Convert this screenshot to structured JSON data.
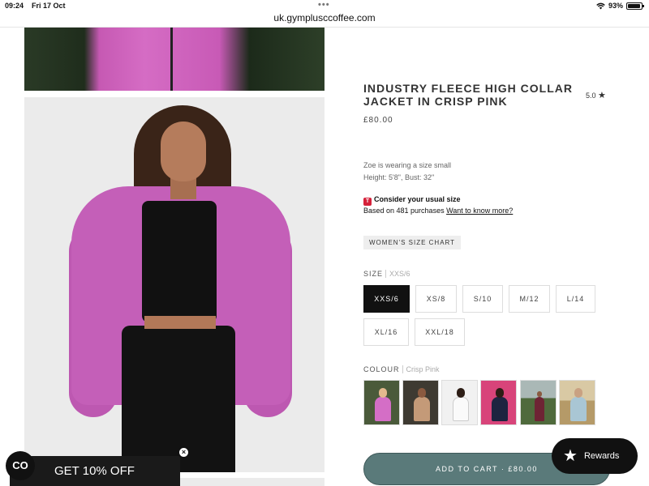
{
  "status_bar": {
    "time": "09:24",
    "date": "Fri 17 Oct",
    "battery": "93%",
    "battery_level": 0.93
  },
  "browser": {
    "url": "uk.gymplusccoffee.com"
  },
  "product": {
    "title": "INDUSTRY FLEECE HIGH COLLAR JACKET IN CRISP PINK",
    "rating": "5.0",
    "price": "£80.00",
    "model_info_line1": "Zoe is wearing a size small",
    "model_info_line2": "Height: 5'8\", Bust: 32\"",
    "fit_icon": "T",
    "fit_title": "Consider your usual size",
    "fit_text": "Based on 481 purchases ",
    "fit_link": "Want to know more?",
    "size_chart_label": "WOMEN'S SIZE CHART",
    "size_label": "SIZE",
    "selected_size": "XXS/6",
    "sizes": [
      "XXS/6",
      "XS/8",
      "S/10",
      "M/12",
      "L/14",
      "XL/16",
      "XXL/18"
    ],
    "colour_label": "COLOUR",
    "selected_colour": "Crisp Pink",
    "colour_swatches": [
      "pink-fleece-thumb",
      "tan-fleece-thumb",
      "white-fleece-thumb",
      "navy-on-pink-thumb",
      "maroon-outdoor-thumb",
      "light-blue-outdoor-thumb"
    ],
    "add_to_cart": "ADD TO CART · £80.00"
  },
  "rewards": {
    "label": "Rewards"
  },
  "promo": {
    "badge": "CO",
    "text": "GET 10% OFF",
    "close": "×"
  },
  "colors": {
    "jacket_pink": "#c45fb8",
    "cart_button": "#5a7a7a",
    "selected_size_bg": "#111111",
    "fit_icon_red": "#d5213a"
  }
}
